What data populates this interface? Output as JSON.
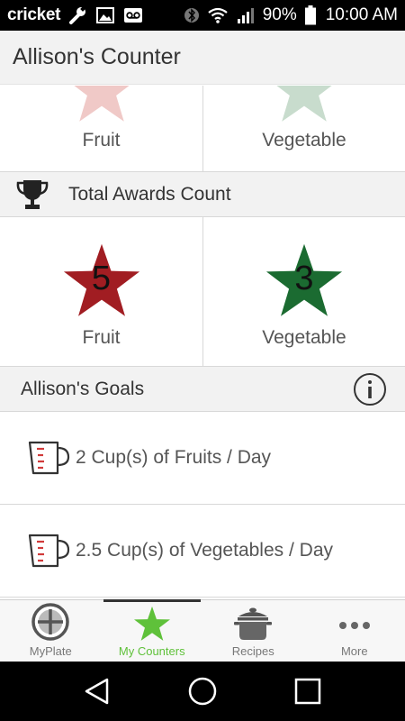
{
  "status_bar": {
    "carrier": "cricket",
    "battery": "90%",
    "time": "10:00 AM"
  },
  "app_bar": {
    "title": "Allison's Counter"
  },
  "weekly_awards": {
    "items": [
      {
        "label": "Fruit",
        "color": "#f0c9c7"
      },
      {
        "label": "Vegetable",
        "color": "#c8dccd"
      }
    ]
  },
  "total_awards": {
    "title": "Total Awards Count",
    "items": [
      {
        "label": "Fruit",
        "count": "5",
        "color": "#a11d22"
      },
      {
        "label": "Vegetable",
        "count": "3",
        "color": "#1b6b31"
      }
    ]
  },
  "goals": {
    "title": "Allison's Goals",
    "items": [
      {
        "text": "2 Cup(s) of Fruits / Day"
      },
      {
        "text": "2.5 Cup(s) of Vegetables / Day"
      }
    ]
  },
  "bottom_nav": {
    "items": [
      {
        "label": "MyPlate",
        "icon": "myplate-icon"
      },
      {
        "label": "My Counters",
        "icon": "star-icon",
        "active": true
      },
      {
        "label": "Recipes",
        "icon": "pot-icon"
      },
      {
        "label": "More",
        "icon": "more-icon"
      }
    ],
    "active_color": "#5fc13a"
  }
}
